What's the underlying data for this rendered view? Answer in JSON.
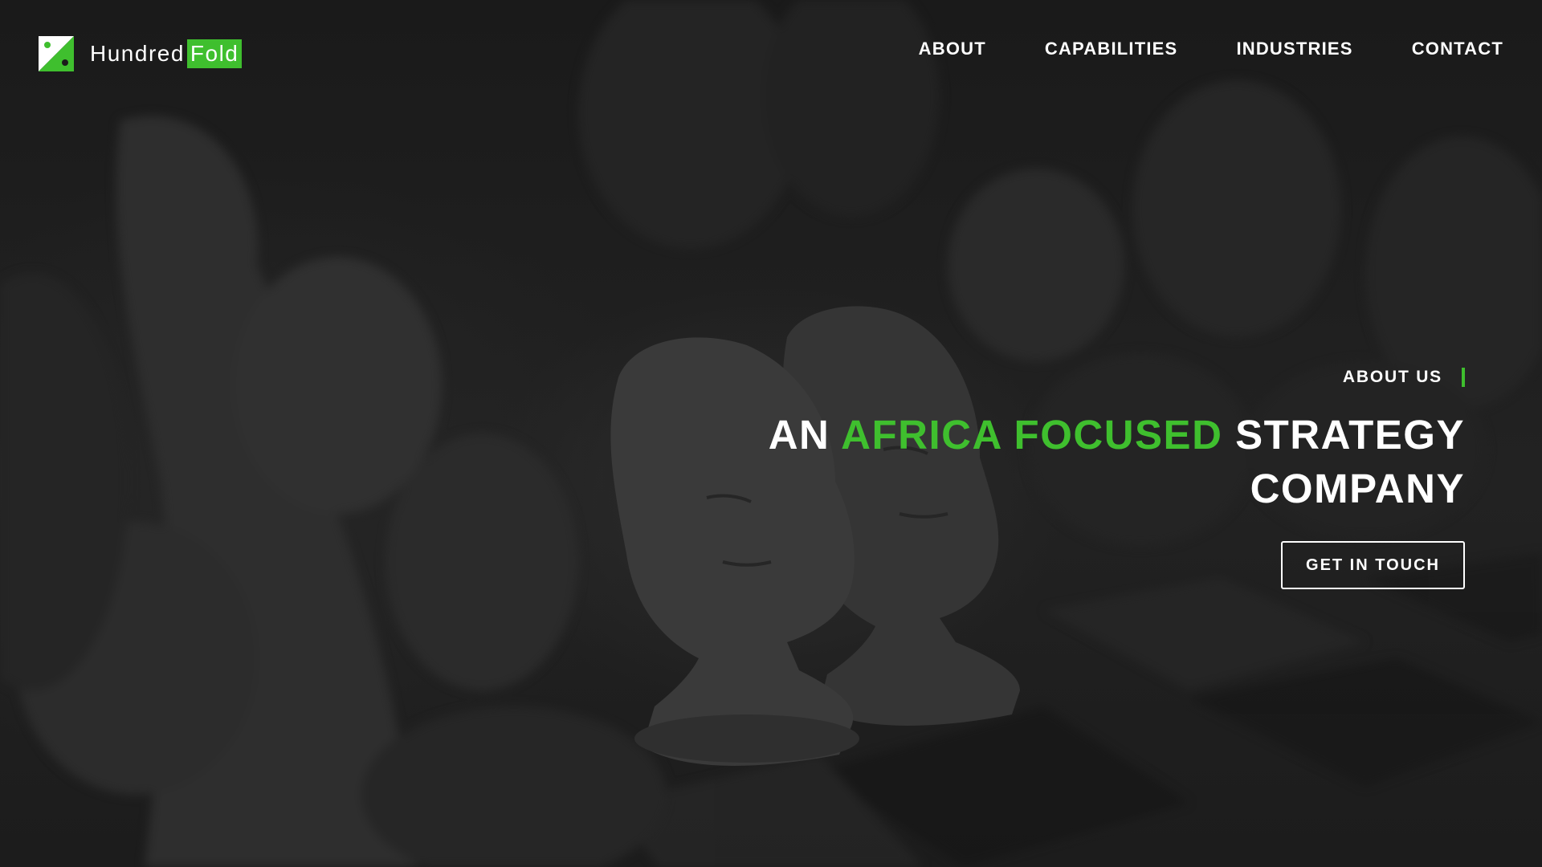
{
  "brand": {
    "name_part1": "Hundred",
    "name_part2": "Fold",
    "accent_color": "#3fbf2e"
  },
  "nav": {
    "items": [
      {
        "label": "ABOUT"
      },
      {
        "label": "CAPABILITIES"
      },
      {
        "label": "INDUSTRIES"
      },
      {
        "label": "CONTACT"
      }
    ]
  },
  "hero": {
    "eyebrow": "ABOUT US",
    "headline_part1": "AN ",
    "headline_accent": "AFRICA FOCUSED",
    "headline_part2": " STRATEGY",
    "headline_line2": "COMPANY",
    "cta_label": "GET IN TOUCH"
  }
}
